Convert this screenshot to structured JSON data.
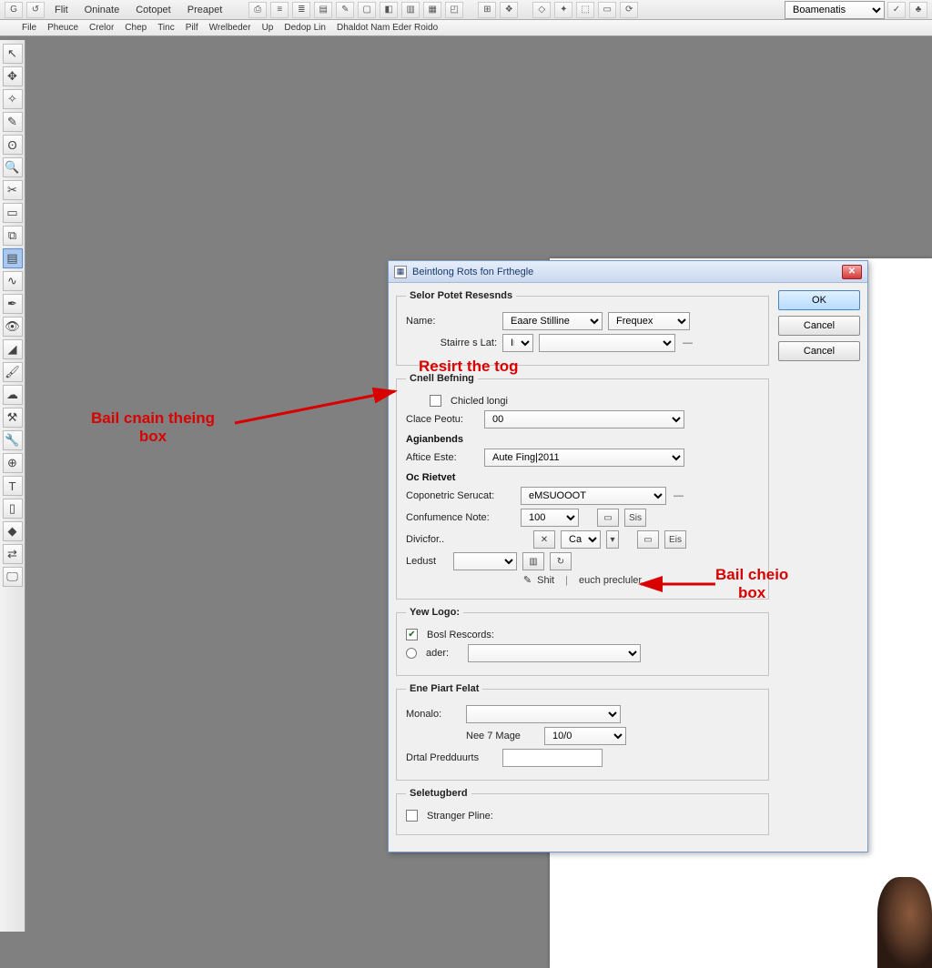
{
  "topbar": {
    "items": [
      "Flit",
      "Oninate",
      "Cotopet",
      "Preapet"
    ],
    "combo": "Boamenatis"
  },
  "menubar2": [
    "File",
    "Pheuce",
    "Crelor",
    "Chep",
    "Tinc",
    "Pilf",
    "Wrelbeder",
    "Up",
    "Dedop Lin",
    "Dhaldot Nam Eder Roido"
  ],
  "dialog": {
    "title": "Beintlong Rots fon Frthegle",
    "buttons": {
      "ok": "OK",
      "cancel1": "Cancel",
      "cancel2": "Cancel"
    },
    "g1": {
      "legend": "Selor Potet Resesnds",
      "name_lbl": "Name:",
      "name_val": "Eaare Stilline",
      "freq_val": "Frequex",
      "state_lbl": "Stairre s Lat:",
      "state_val": "Ime"
    },
    "g2": {
      "legend": "Cnell Befning",
      "chk1": "Chicled longi",
      "clace_lbl": "Clace Peotu:",
      "clace_val": "00",
      "sub_ag": "Agianbends",
      "aft_lbl": "Aftice Este:",
      "aft_val": "Aute Fing|2011",
      "sub_oc": "Oc Rietvet",
      "cop_lbl": "Coponetric Serucat:",
      "cop_val": "eMSUOOOT",
      "conf_lbl": "Confumence Note:",
      "conf_val": "100",
      "div_lbl": "Divicfor..",
      "dedust_lbl": "Ledust",
      "cent_a": "Shit",
      "cent_b": "euch precluler",
      "ca": "Ca",
      "sis": "Sis",
      "eis": "Eis"
    },
    "g3": {
      "legend": "Yew Logo:",
      "chk_rec": "Bosl Rescords:",
      "rad_ader": "ader:"
    },
    "g4": {
      "legend": "Ene Piart Felat",
      "mon_lbl": "Monalo:",
      "nee_lbl": "Nee 7 Mage",
      "nee_val": "10/0",
      "drt_lbl": "Drtal Predduurts"
    },
    "g5": {
      "legend": "Seletugberd",
      "chk_str": "Stranger Pline:"
    }
  },
  "anno": {
    "left": "Bail cnain theing\nbox",
    "top": "Resirt the tog",
    "right": "Bail cheio\nbox"
  }
}
